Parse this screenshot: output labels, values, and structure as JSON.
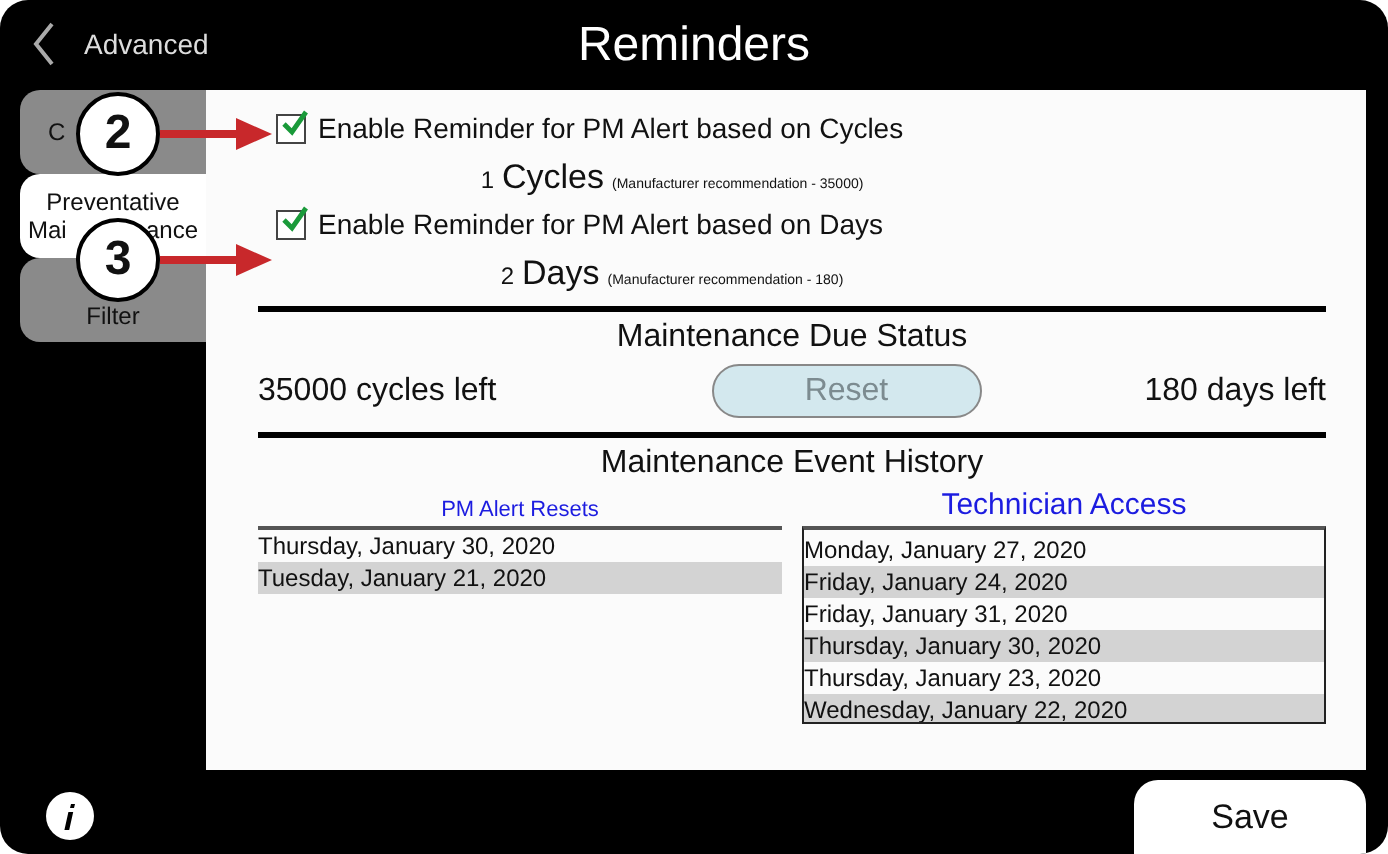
{
  "header": {
    "back_label": "Advanced",
    "title": "Reminders"
  },
  "tabs": [
    {
      "kind": "covered",
      "lines": [
        [
          "C"
        ]
      ],
      "selected": false
    },
    {
      "kind": "covered",
      "lines": [
        [
          "Preventative"
        ],
        [
          "Mai",
          "ance"
        ]
      ],
      "selected": true
    },
    {
      "kind": "plain",
      "lines": [
        [
          "Filter"
        ]
      ],
      "selected": false
    }
  ],
  "callouts": [
    "2",
    "3"
  ],
  "reminders": [
    {
      "label": "Enable Reminder for PM Alert based on Cycles",
      "checked": true,
      "value": "1",
      "unit": "Cycles",
      "note": "(Manufacturer recommendation - 35000)"
    },
    {
      "label": "Enable Reminder for PM Alert based on Days",
      "checked": true,
      "value": "2",
      "unit": "Days",
      "note": "(Manufacturer recommendation - 180)"
    }
  ],
  "due_status": {
    "title": "Maintenance Due Status",
    "cycles_left": "35000 cycles left",
    "reset_label": "Reset",
    "reset_disabled": true,
    "days_left": "180 days left"
  },
  "history": {
    "title": "Maintenance Event History",
    "pm_alert_resets": {
      "heading": "PM Alert Resets",
      "rows": [
        "Thursday, January 30, 2020",
        "Tuesday, January 21, 2020"
      ]
    },
    "technician_access": {
      "heading": "Technician Access",
      "rows": [
        "Monday, January 27, 2020",
        "Friday, January 24, 2020",
        "Friday, January 31, 2020",
        "Thursday, January 30, 2020",
        "Thursday, January 23, 2020",
        "Wednesday, January 22, 2020"
      ]
    }
  },
  "save_label": "Save"
}
